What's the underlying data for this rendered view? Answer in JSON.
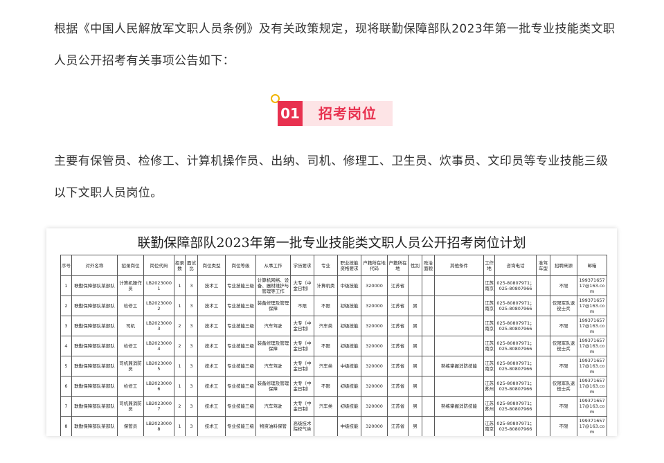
{
  "intro": "根据《中国人民解放军文职人员条例》及有关政策规定，现将联勤保障部队2023年第一批专业技能类文职人员公开招考有关事项公告如下：",
  "section": {
    "number": "01",
    "title": "招考岗位"
  },
  "posts_paragraph": "主要有保管员、检修工、计算机操作员、出纳、司机、修理工、卫生员、炊事员、文印员等专业技能三级以下文职人员岗位。",
  "plan_table": {
    "title": "联勤保障部队2023年第一批专业技能类文职人员公开招考岗位计划",
    "headers": [
      "序号",
      "对外名称",
      "招录岗位",
      "岗位代码",
      "招录数",
      "面试比",
      "岗位类型",
      "岗位等级",
      "从事工作",
      "学历要求",
      "专业",
      "职业技能资格要求",
      "户籍所在地代码",
      "户籍所在地",
      "性别",
      "政治面貌",
      "其他条件",
      "工作地",
      "咨询电话",
      "准驾车型",
      "招聘来源",
      "邮箱"
    ],
    "rows": [
      [
        "1",
        "联勤保障部队某部队",
        "计算机操作员",
        "LB20230001",
        "1",
        "3",
        "技术工",
        "专业技能三级",
        "计算机网络、设备、器材维护与管理等工作",
        "大专（中金日制）",
        "计算机类",
        "中级技能",
        "320000",
        "江苏省",
        "",
        "",
        "",
        "江苏南京",
        "025-80807971；025-80807966",
        "",
        "不限",
        "19937165717@163.com"
      ],
      [
        "2",
        "联勤保障部队某部队",
        "检修工",
        "LB20230002",
        "1",
        "3",
        "技术工",
        "专业技能三级",
        "装备修理及管理保障",
        "不限",
        "不限",
        "初级技能",
        "320000",
        "江苏省",
        "男",
        "",
        "",
        "江苏南京",
        "025-80807971；025-80807966",
        "",
        "仅限军队退役士兵",
        "19937165717@163.com"
      ],
      [
        "3",
        "联勤保障部队某部队",
        "司机",
        "LB20230003",
        "2",
        "3",
        "技术工",
        "专业技能三级",
        "汽车驾驶",
        "大专（中金日制）",
        "汽车类",
        "初级技能",
        "320000",
        "江苏省",
        "男",
        "",
        "",
        "江苏南京",
        "025-80807971；025-80807966",
        "",
        "不限",
        "19937165717@163.com"
      ],
      [
        "4",
        "联勤保障部队某部队",
        "检修工",
        "LB20230004",
        "2",
        "3",
        "技术工",
        "专业技能三级",
        "装备修理及管理保障",
        "大专（中金日制）",
        "不限",
        "初级技能",
        "320000",
        "江苏省",
        "男",
        "",
        "",
        "江苏南京",
        "025-80807971；025-80807966",
        "",
        "仅限军队退役士兵",
        "19937165717@163.com"
      ],
      [
        "5",
        "联勤保障部队某部队",
        "司机兼消防员",
        "LB20230005",
        "1",
        "3",
        "技术工",
        "专业技能三级",
        "汽车驾驶",
        "大专（中金日制）",
        "汽车类",
        "中级技能",
        "320000",
        "江苏省",
        "男",
        "",
        "熟练掌握消防技能",
        "江苏南京",
        "025-80807971；025-80807966",
        "",
        "不限",
        "19937165717@163.com"
      ],
      [
        "6",
        "联勤保障部队某部队",
        "检修工",
        "LB20230006",
        "1",
        "3",
        "技术工",
        "专业技能三级",
        "装备修理及管理保障",
        "大专（中金日制）",
        "不限",
        "初级技能",
        "320000",
        "江苏省",
        "男",
        "",
        "",
        "江苏苏州",
        "025-80807971；025-80807966",
        "",
        "仅限军队退役士兵",
        "19937165717@163.com"
      ],
      [
        "7",
        "联勤保障部队某部队",
        "司机兼消防员",
        "LB20230007",
        "2",
        "3",
        "技术工",
        "专业技能三级",
        "汽车驾驶",
        "大专（中金日制）",
        "汽车类",
        "初级技能",
        "320000",
        "江苏省",
        "男",
        "",
        "熟练掌握消防技能",
        "江苏苏州",
        "025-80807971；025-80807966",
        "",
        "不限",
        "19937165717@163.com"
      ],
      [
        "8",
        "联勤保障部队某部队",
        "保管员",
        "LB20230008",
        "1",
        "3",
        "技术工",
        "专业技能三级",
        "物资油料保管",
        "高级技术院校气类",
        "",
        "中级技能",
        "320000",
        "江苏省",
        "男",
        "",
        "",
        "江苏南京",
        "025-80807971；025-80807966",
        "",
        "不限",
        "19937165717@163.com"
      ]
    ]
  }
}
